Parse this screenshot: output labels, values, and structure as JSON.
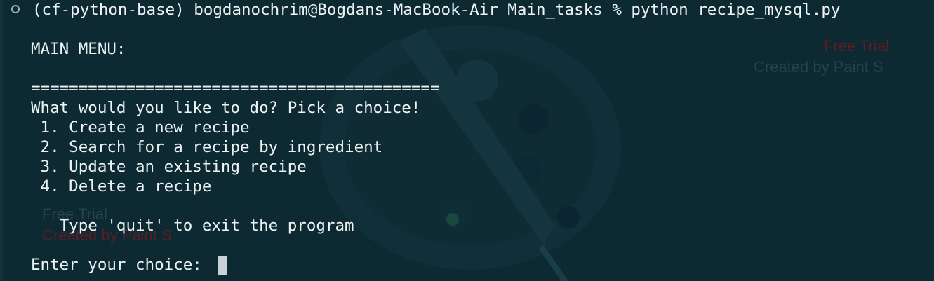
{
  "command_line": "(cf-python-base) bogdanochrim@Bogdans-MacBook-Air Main_tasks % python recipe_mysql.py",
  "menu_title": "MAIN MENU:",
  "separator": "===========================================",
  "question": "What would you like to do? Pick a choice!",
  "options": [
    " 1. Create a new recipe",
    " 2. Search for a recipe by ingredient",
    " 3. Update an existing recipe",
    " 4. Delete a recipe"
  ],
  "quit_hint": "   Type 'quit' to exit the program",
  "input_prompt": "Enter your choice: ",
  "watermarks": {
    "top_right_line1": "Free Trial",
    "top_right_line2": "Created by Paint S",
    "bottom_left_line1": "Free Trial",
    "bottom_left_line2": "Created by Paint S"
  },
  "colors": {
    "background": "#0d2a33",
    "text": "#eef3f5",
    "cursor": "#c9d3d6"
  }
}
